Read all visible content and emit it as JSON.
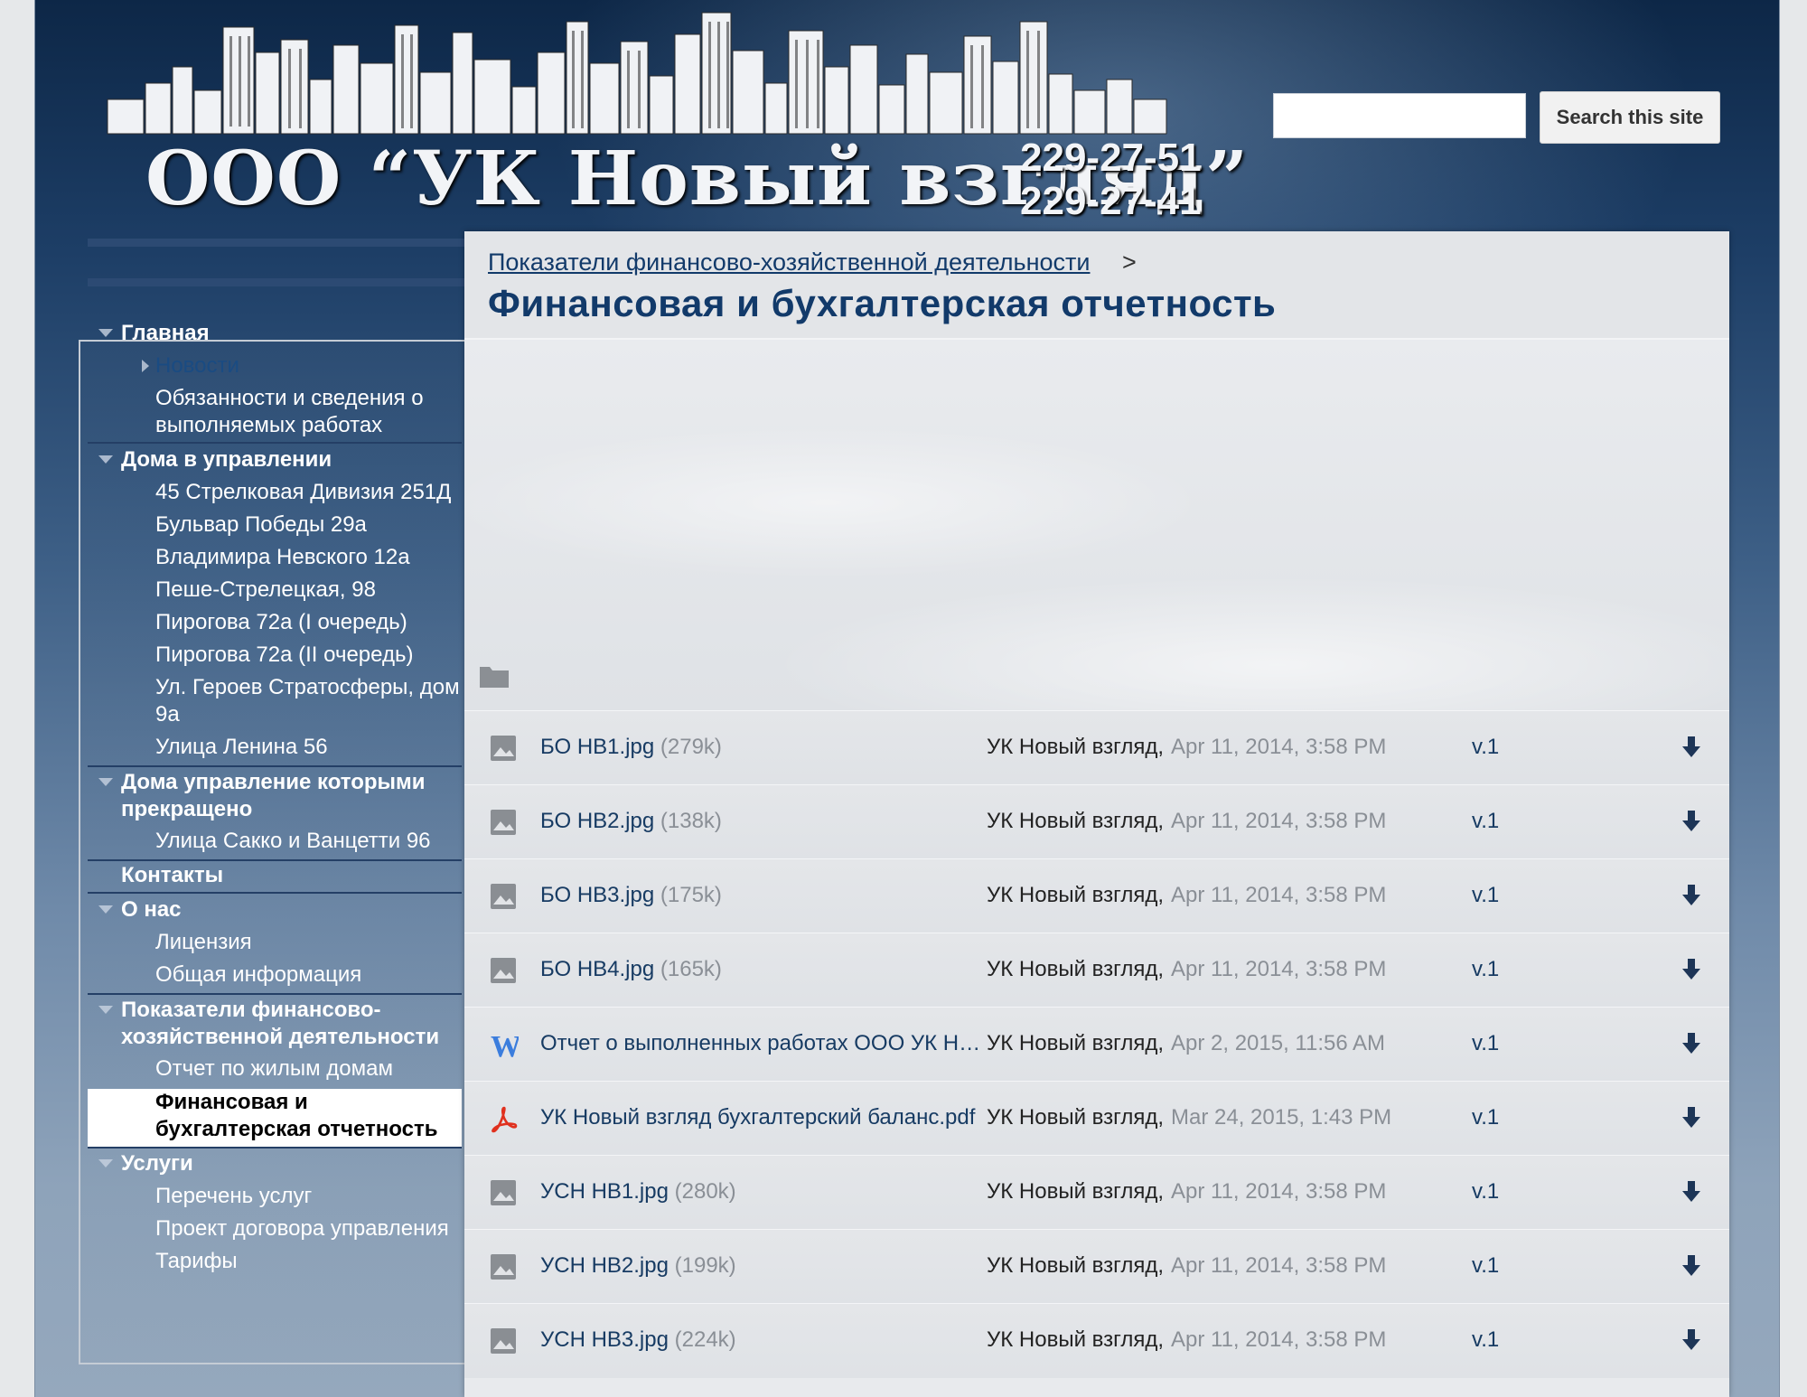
{
  "header": {
    "site_name": "ООО “УК Новый взгляд”",
    "phone_1": "229-27-51",
    "phone_2": "229-27-41",
    "search_button_label": "Search this site",
    "search_value": ""
  },
  "sidebar": {
    "items": [
      {
        "label": "Главная",
        "level": 1
      },
      {
        "label": "Новости",
        "level": 2
      },
      {
        "label": "Обязанности и сведения о выполняемых работах",
        "level": 2
      },
      {
        "label": "Дома в управлении",
        "level": 1
      },
      {
        "label": "45 Стрелковая Дивизия 251Д",
        "level": 2
      },
      {
        "label": "Бульвар Победы 29а",
        "level": 2
      },
      {
        "label": "Владимира Невского 12а",
        "level": 2
      },
      {
        "label": "Пеше-Стрелецкая, 98",
        "level": 2
      },
      {
        "label": "Пирогова 72а (I очередь)",
        "level": 2
      },
      {
        "label": "Пирогова 72а (II очередь)",
        "level": 2
      },
      {
        "label": "Ул. Героев Стратосферы, дом 9а",
        "level": 2
      },
      {
        "label": "Улица Ленина 56",
        "level": 2
      },
      {
        "label": "Дома управление которыми прекращено",
        "level": 1
      },
      {
        "label": "Улица Сакко и Ванцетти 96",
        "level": 2
      },
      {
        "label": "Контакты",
        "level": 1
      },
      {
        "label": "О нас",
        "level": 1
      },
      {
        "label": "Лицензия",
        "level": 2
      },
      {
        "label": "Общая информация",
        "level": 2
      },
      {
        "label": "Показатели финансово-хозяйственной деятельности",
        "level": 1
      },
      {
        "label": "Отчет по жилым домам",
        "level": 2
      },
      {
        "label": "Финансовая и бухгалтерская отчетность",
        "level": 2,
        "active": true
      },
      {
        "label": "Услуги",
        "level": 1
      },
      {
        "label": "Перечень услуг",
        "level": 2
      },
      {
        "label": "Проект договора управления",
        "level": 2
      },
      {
        "label": "Тарифы",
        "level": 2
      }
    ]
  },
  "main": {
    "breadcrumb": "Показатели финансово-хозяйственной деятельности",
    "breadcrumb_separator": ">",
    "title": "Финансовая и бухгалтерская отчетность",
    "files": [
      {
        "icon": "image-icon",
        "name": "БО НВ1.jpg",
        "size": "(279k)",
        "owner": "УК Новый взгляд,",
        "date": "Apr 11, 2014, 3:58 PM",
        "version": "v.1"
      },
      {
        "icon": "image-icon",
        "name": "БО НВ2.jpg",
        "size": "(138k)",
        "owner": "УК Новый взгляд,",
        "date": "Apr 11, 2014, 3:58 PM",
        "version": "v.1"
      },
      {
        "icon": "image-icon",
        "name": "БО НВ3.jpg",
        "size": "(175k)",
        "owner": "УК Новый взгляд,",
        "date": "Apr 11, 2014, 3:58 PM",
        "version": "v.1"
      },
      {
        "icon": "image-icon",
        "name": "БО НВ4.jpg",
        "size": "(165k)",
        "owner": "УК Новый взгляд,",
        "date": "Apr 11, 2014, 3:58 PM",
        "version": "v.1"
      },
      {
        "icon": "word-icon",
        "name": "Отчет о выполненных работах ООО УК Н…",
        "size": "",
        "owner": "УК Новый взгляд,",
        "date": "Apr 2, 2015, 11:56 AM",
        "version": "v.1"
      },
      {
        "icon": "pdf-icon",
        "name": "УК Новый взгляд бухгалтерский баланс.pdf",
        "size": "",
        "owner": "УК Новый взгляд,",
        "date": "Mar 24, 2015, 1:43 PM",
        "version": "v.1"
      },
      {
        "icon": "image-icon",
        "name": "УСН НВ1.jpg",
        "size": "(280k)",
        "owner": "УК Новый взгляд,",
        "date": "Apr 11, 2014, 3:58 PM",
        "version": "v.1"
      },
      {
        "icon": "image-icon",
        "name": "УСН НВ2.jpg",
        "size": "(199k)",
        "owner": "УК Новый взгляд,",
        "date": "Apr 11, 2014, 3:58 PM",
        "version": "v.1"
      },
      {
        "icon": "image-icon",
        "name": "УСН НВ3.jpg",
        "size": "(224k)",
        "owner": "УК Новый взгляд,",
        "date": "Apr 11, 2014, 3:58 PM",
        "version": "v.1"
      }
    ]
  },
  "colors": {
    "link": "#123a6a",
    "header_bg": "#0d2747",
    "muted": "#8a8f96",
    "pdf_red": "#e0301e",
    "word_blue": "#3b7ddd"
  }
}
